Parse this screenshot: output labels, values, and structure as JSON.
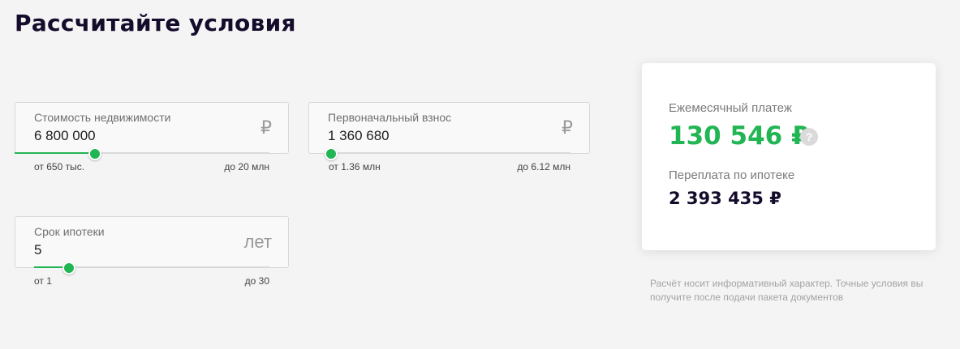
{
  "page": {
    "title": "Рассчитайте условия"
  },
  "fields": {
    "price": {
      "label": "Стоимость недвижимости",
      "value": "6 800 000",
      "unit": "₽",
      "min_label": "от 650 тыс.",
      "max_label": "до 20 млн",
      "slider_fraction": 0.31
    },
    "down_payment": {
      "label": "Первоначальный взнос",
      "value": "1 360 680",
      "unit": "₽",
      "min_label": "от 1.36 млн",
      "max_label": "до 6.12 млн",
      "slider_fraction": 0.0
    },
    "term": {
      "label": "Срок ипотеки",
      "value": "5",
      "unit": "лет",
      "min_label": "от 1",
      "max_label": "до 30",
      "slider_fraction": 0.14
    }
  },
  "result": {
    "monthly_label": "Ежемесячный платеж",
    "monthly_value": "130 546 ₽",
    "help_icon": "?",
    "overpay_label": "Переплата по ипотеке",
    "overpay_value": "2 393 435 ₽"
  },
  "disclaimer": "Расчёт носит информативный характер. Точные условия вы получите после подачи пакета документов",
  "colors": {
    "accent": "#21b553",
    "title": "#150c2c",
    "background": "#f4f4f4"
  }
}
